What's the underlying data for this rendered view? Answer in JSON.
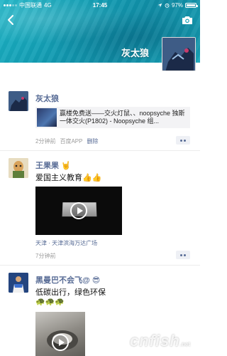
{
  "status_bar": {
    "carrier": "中国联通",
    "network": "4G",
    "time": "17:45",
    "battery": "97%",
    "battery_level": 0.97
  },
  "profile": {
    "name": "灰太狼"
  },
  "posts": [
    {
      "author": "灰太狼",
      "share_title": "赢楼免费送——交火灯鼠、、noopsyche 独斯一体交火(P1802) - Noopsyche 组...",
      "time": "2分钟前",
      "source": "百度APP",
      "delete_label": "删除"
    },
    {
      "author": "王果果",
      "author_emoji": "🤘",
      "text": "爱国主义教育👍👍",
      "location": "天津 · 天津滨海万达广场",
      "time": "7分钟前"
    },
    {
      "author": "黑曼巴不会飞@",
      "author_emoji": "😎",
      "text": "低碳出行，绿色环保",
      "text_emoji": "🐢🐢🐢"
    }
  ],
  "watermark": {
    "main": "cnfish",
    "suffix": ".net"
  },
  "colors": {
    "link": "#576b95",
    "meta": "#9a9a9a",
    "cover": "#139fb5"
  }
}
